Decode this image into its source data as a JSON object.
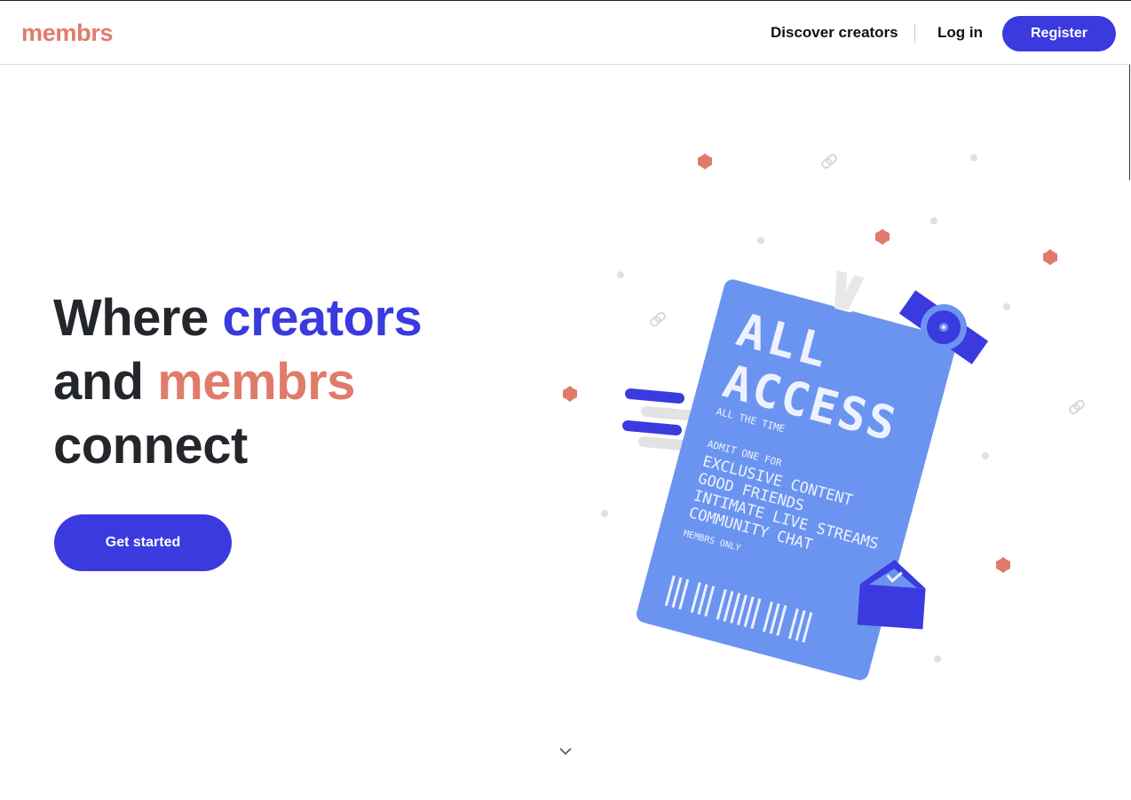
{
  "brand": {
    "name": "membrs",
    "color": "#e07b6a"
  },
  "colors": {
    "primary": "#3a3adf",
    "accent": "#e07b6a",
    "ticket": "#6b94f0",
    "text": "#23272b"
  },
  "nav": {
    "discover_label": "Discover creators",
    "login_label": "Log in",
    "register_label": "Register"
  },
  "hero": {
    "title_part1": "Where ",
    "title_highlight1": "creators",
    "title_part2": "and ",
    "title_highlight2": "membrs",
    "title_part3": "connect",
    "cta_label": "Get started"
  },
  "ticket": {
    "headline_line1": "ALL",
    "headline_line2": "ACCESS",
    "subline": "ALL THE TIME",
    "admit": "ADMIT ONE FOR",
    "perks": [
      "EXCLUSIVE CONTENT",
      "GOOD FRIENDS",
      "INTIMATE LIVE STREAMS",
      "COMMUNITY CHAT"
    ],
    "footer": "MEMBRS ONLY"
  },
  "icons": {
    "scroll": "chevron-down-icon",
    "link": "link-icon",
    "star": "star-icon",
    "mail": "envelope-icon"
  }
}
